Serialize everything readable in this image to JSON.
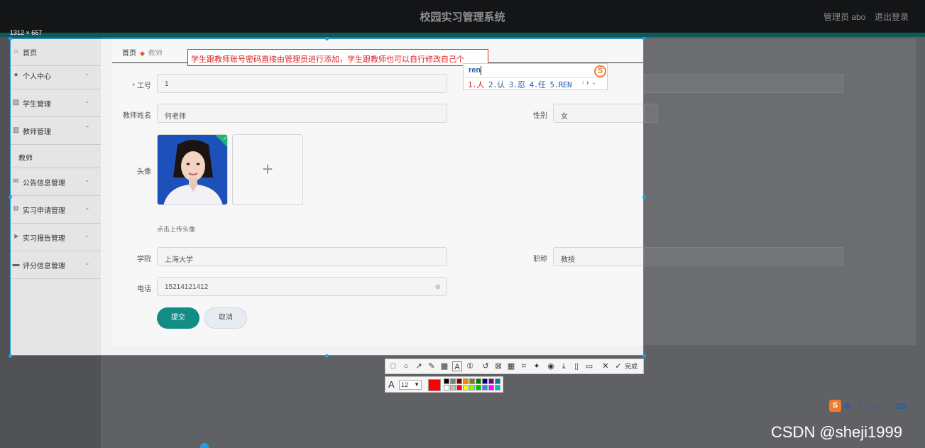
{
  "header": {
    "title": "校园实习管理系统",
    "user": "管理员 abo",
    "logout": "退出登录"
  },
  "capture_size": "1312 × 657",
  "sidebar": {
    "items": [
      {
        "label": "首页",
        "icon": "home-icon"
      },
      {
        "label": "个人中心",
        "icon": "user-icon"
      },
      {
        "label": "学生管理",
        "icon": "chart-icon"
      },
      {
        "label": "教师管理",
        "icon": "bar-chart-icon"
      },
      {
        "label": "公告信息管理",
        "icon": "mail-icon"
      },
      {
        "label": "实习申请管理",
        "icon": "settings-icon"
      },
      {
        "label": "实习报告管理",
        "icon": "send-icon"
      },
      {
        "label": "评分信息管理",
        "icon": "monitor-icon"
      }
    ],
    "sub_active": "教师"
  },
  "breadcrumb": {
    "home": "首页",
    "current": "教师"
  },
  "form": {
    "gonghao": {
      "label": "工号",
      "value": "1"
    },
    "name": {
      "label": "教师姓名",
      "value": "何老师"
    },
    "gender": {
      "label": "性别",
      "value": "女"
    },
    "avatar": {
      "label": "头像",
      "hint": "点击上传头像"
    },
    "college": {
      "label": "学院",
      "value": "上海大学"
    },
    "title": {
      "label": "职称",
      "value": "教授"
    },
    "phone": {
      "label": "电话",
      "value": "15214121412"
    },
    "submit": "提交",
    "cancel": "取消"
  },
  "annotation": "学生跟教师账号密码直接由管理员进行添加，学生跟教师也可以自行修改自己个",
  "ime": {
    "composition": "ren",
    "candidates": [
      "1.人",
      "2.认",
      "3.忍",
      "4.任",
      "5.REN"
    ]
  },
  "toolbar": {
    "done": "完成",
    "font_size": "12"
  },
  "colors": {
    "accent": "#138c85",
    "annotation": "#e02020",
    "palette": [
      "#000000",
      "#808080",
      "#800000",
      "#ff8000",
      "#808000",
      "#008000",
      "#000080",
      "#800080",
      "#008080",
      "#ffffff",
      "#c0c0c0",
      "#ff0000",
      "#ffff00",
      "#80ff00",
      "#00c000",
      "#4080ff",
      "#ff00ff",
      "#00c0c0"
    ]
  },
  "imebar": {
    "text": "中 °, ☺ ♪ ⌨"
  },
  "watermark": "CSDN @sheji1999"
}
